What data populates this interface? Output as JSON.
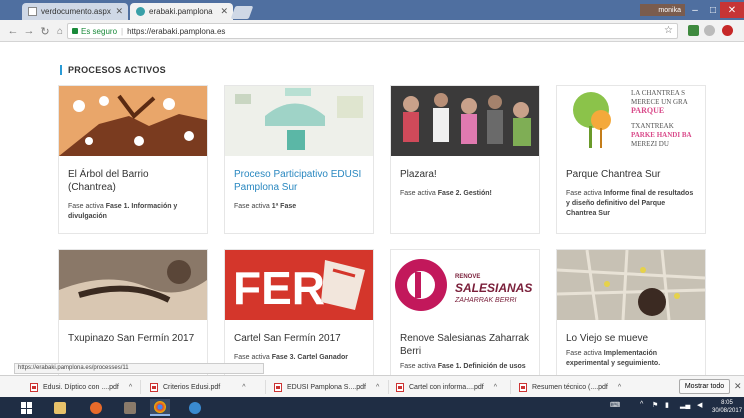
{
  "browser": {
    "tabs": [
      {
        "title": "verdocumento.aspx",
        "icon": "document-icon",
        "active": false
      },
      {
        "title": "erabaki.pamplona",
        "icon": "globe-icon",
        "active": true
      }
    ],
    "user_name": "monika",
    "address": {
      "secure_label": "Es seguro",
      "url": "https://erabaki.pamplona.es"
    }
  },
  "page": {
    "section_title": "PROCESOS ACTIVOS",
    "cards": [
      {
        "title": "El Árbol del Barrio (Chantrea)",
        "link": false,
        "phase_prefix": "Fase activa ",
        "phase_bold": "Fase 1. Información y divulgación",
        "phase_suffix": "",
        "thumb": "t-arbol"
      },
      {
        "title": "Proceso Participativo EDUSI Pamplona Sur",
        "link": true,
        "phase_prefix": "Fase activa ",
        "phase_bold": "1ª Fase",
        "phase_suffix": "",
        "thumb": "t-edusi"
      },
      {
        "title": "Plazara!",
        "link": false,
        "phase_prefix": "Fase activa ",
        "phase_bold": "Fase 2. Gestión!",
        "phase_suffix": "",
        "thumb": "t-plazara"
      },
      {
        "title": "Parque Chantrea Sur",
        "link": false,
        "phase_prefix": "Fase activa ",
        "phase_bold": "Informe final de resultados y diseño definitivo del Parque Chantrea Sur",
        "phase_suffix": "",
        "thumb": "t-parque"
      },
      {
        "title": "Txupinazo San Fermín 2017",
        "link": false,
        "phase_prefix": "",
        "phase_bold": "",
        "phase_suffix": "",
        "thumb": "t-txupi"
      },
      {
        "title": "Cartel San Fermín 2017",
        "link": false,
        "phase_prefix": "Fase activa ",
        "phase_bold": "Fase 3. Cartel Ganador",
        "phase_suffix": "",
        "thumb": "t-cartel"
      },
      {
        "title": "Renove Salesianas Zaharrak Berri",
        "link": false,
        "phase_prefix": "Fase activa ",
        "phase_bold": "Fase 1. Definición de usos",
        "phase_suffix": "",
        "thumb": "t-renove"
      },
      {
        "title": "Lo Viejo se mueve",
        "link": false,
        "phase_prefix": "Fase activa ",
        "phase_bold": "Implementación experimental y seguimiento.",
        "phase_suffix": "",
        "thumb": "t-viejo"
      }
    ],
    "thumb_text": {
      "parque_line1": "LA CHANTREA S",
      "parque_line2": "MERECE UN GRA",
      "parque_line3": "PARQUE",
      "parque_line4": "TXANTREAK",
      "parque_line5": "PARKE HANDI BA",
      "parque_line6": "MEREZI DU",
      "renove_line1": "RENOVE",
      "renove_line2": "SALESIANAS",
      "renove_line3": "ZAHARRAK BERRI",
      "cartel_text": "FER"
    }
  },
  "status_url": "https://erabaki.pamplona.es/processes/11",
  "downloads": {
    "items": [
      {
        "name": "Edusi. Díptico con ....pdf"
      },
      {
        "name": "Criterios Edusi.pdf"
      },
      {
        "name": "EDUSI Pamplona S....pdf"
      },
      {
        "name": "Cartel con informa....pdf"
      },
      {
        "name": "Resumen técnico (....pdf"
      }
    ],
    "show_all_label": "Mostrar todo"
  },
  "taskbar": {
    "time": "8:05",
    "date": "30/08/2017"
  },
  "colors": {
    "accent": "#2a9bd6",
    "link": "#2a88c0",
    "secure": "#1a8a3a"
  }
}
